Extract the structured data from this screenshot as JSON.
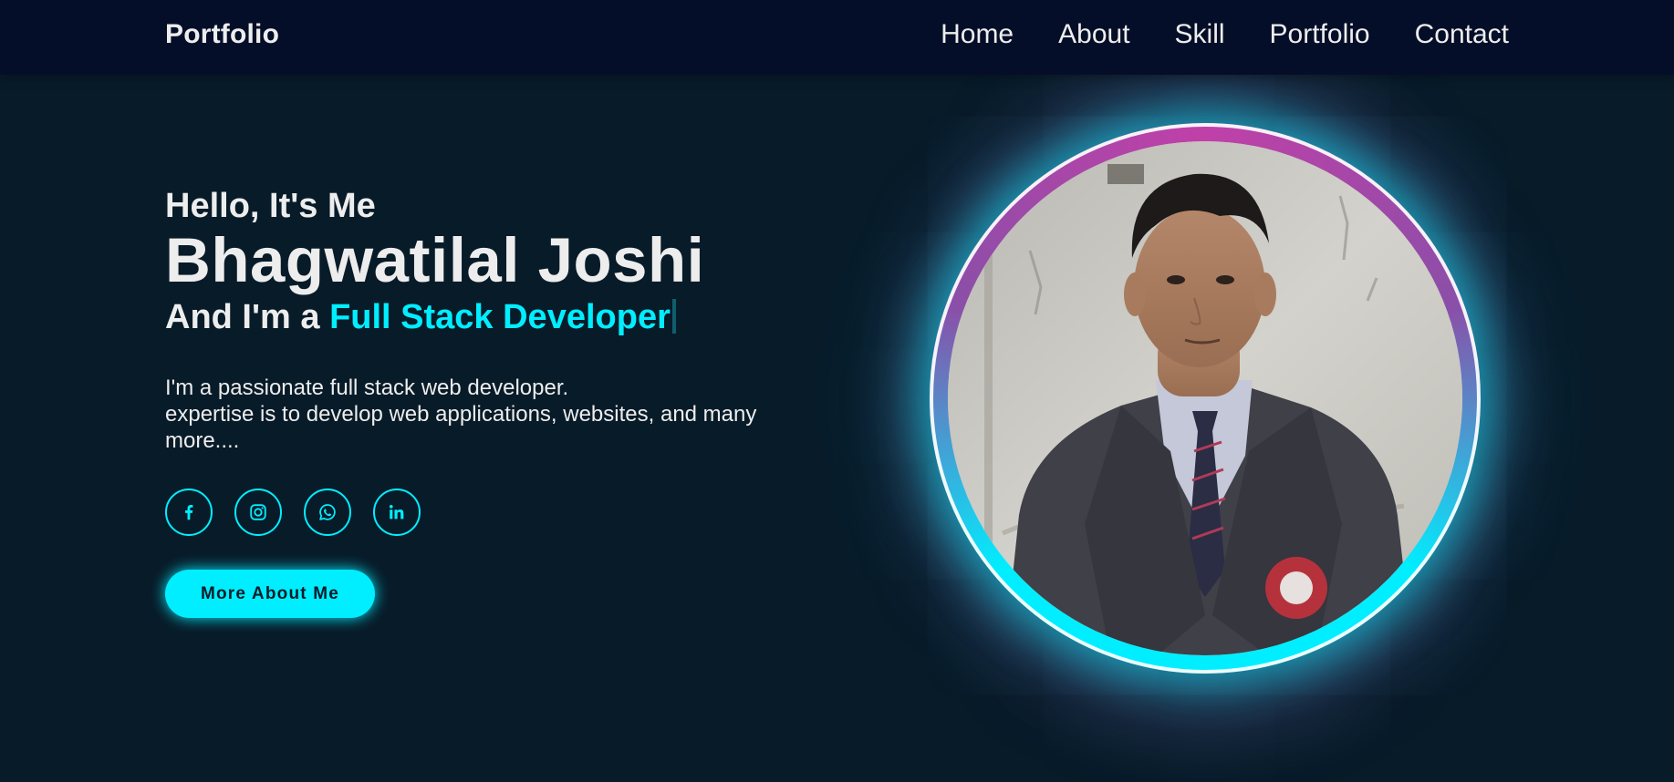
{
  "header": {
    "logo": "Portfolio",
    "nav": [
      "Home",
      "About",
      "Skill",
      "Portfolio",
      "Contact"
    ]
  },
  "home": {
    "greeting": "Hello, It's Me",
    "name": "Bhagwatilal Joshi",
    "role_prefix": "And I'm a ",
    "role_highlight": "Full Stack Developer",
    "description_line1": "I'm a passionate full stack web developer.",
    "description_line2": "expertise is to develop web applications, websites, and many more....",
    "socials": [
      {
        "icon": "facebook-icon"
      },
      {
        "icon": "instagram-icon"
      },
      {
        "icon": "whatsapp-icon"
      },
      {
        "icon": "linkedin-icon"
      }
    ],
    "button_label": "More About Me",
    "photo_alt": "profile photo"
  },
  "colors": {
    "background": "#081b29",
    "header_bg": "#050e28",
    "accent": "#00eeff",
    "glow_secondary": "#c040a8",
    "text": "#ededed"
  }
}
